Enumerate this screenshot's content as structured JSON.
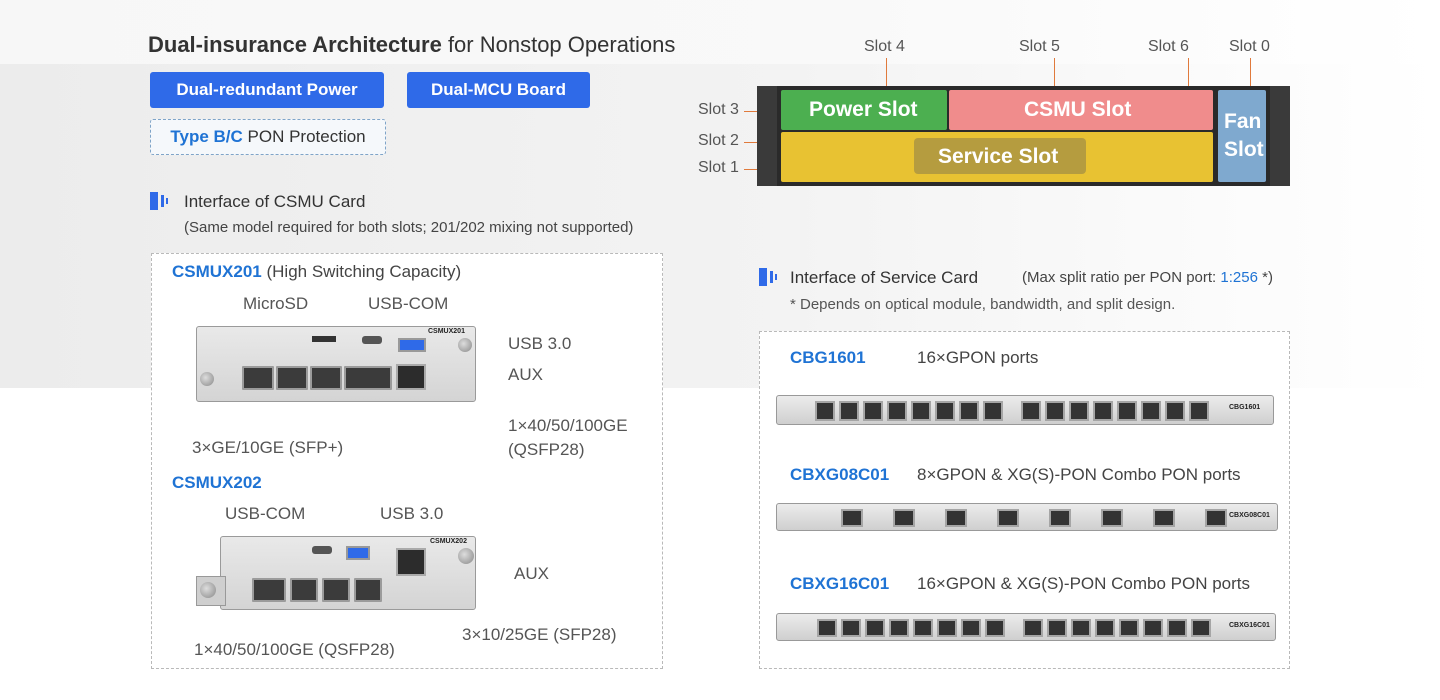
{
  "header": {
    "title_bold": "Dual-insurance Architecture",
    "title_rest": " for Nonstop Operations"
  },
  "tags": {
    "power": "Dual-redundant Power",
    "mcu": "Dual-MCU Board",
    "pon_highlight": "Type B/C",
    "pon_rest": " PON Protection"
  },
  "chassis": {
    "slots": {
      "slot4": "Slot 4",
      "slot5": "Slot 5",
      "slot6": "Slot 6",
      "slot0": "Slot 0",
      "slot3": "Slot 3",
      "slot2": "Slot 2",
      "slot1": "Slot 1"
    },
    "zones": {
      "power": "Power Slot",
      "csmu": "CSMU Slot",
      "service": "Service Slot",
      "fan_line1": "Fan",
      "fan_line2": "Slot"
    },
    "colors": {
      "power": "#4caf50",
      "csmu": "#f08080",
      "service": "#e8c232",
      "fan": "#7fa9cf"
    }
  },
  "csmu": {
    "heading": "Interface of CSMU Card",
    "note": "(Same model required for both slots; 201/202 mixing not supported)",
    "x201": {
      "model": "CSMUX201",
      "desc": " (High Switching Capacity)",
      "callouts": {
        "microsd": "MicroSD",
        "usbcom": "USB-COM",
        "usb3": "USB 3.0",
        "aux": "AUX",
        "qsfp_line1": "1×40/50/100GE",
        "qsfp_line2": "(QSFP28)",
        "sfp": "3×GE/10GE (SFP+)"
      },
      "silk": "CSMUX201"
    },
    "x202": {
      "model": "CSMUX202",
      "callouts": {
        "usbcom": "USB-COM",
        "usb3": "USB 3.0",
        "aux": "AUX",
        "sfp28": "3×10/25GE (SFP28)",
        "qsfp": "1×40/50/100GE (QSFP28)"
      },
      "silk": "CSMUX202"
    }
  },
  "service": {
    "heading": "Interface of Service Card",
    "split_prefix": "(Max split ratio per PON port: ",
    "split_value": "1:256",
    "split_suffix": " *)",
    "footnote": "* Depends on optical module, bandwidth, and split design.",
    "cards": [
      {
        "model": "CBG1601",
        "desc": "16×GPON ports",
        "silk": "CBG1601"
      },
      {
        "model": "CBXG08C01",
        "desc": "8×GPON & XG(S)-PON Combo PON ports",
        "silk": "CBXG08C01"
      },
      {
        "model": "CBXG16C01",
        "desc": "16×GPON & XG(S)-PON Combo PON ports",
        "silk": "CBXG16C01"
      }
    ]
  }
}
